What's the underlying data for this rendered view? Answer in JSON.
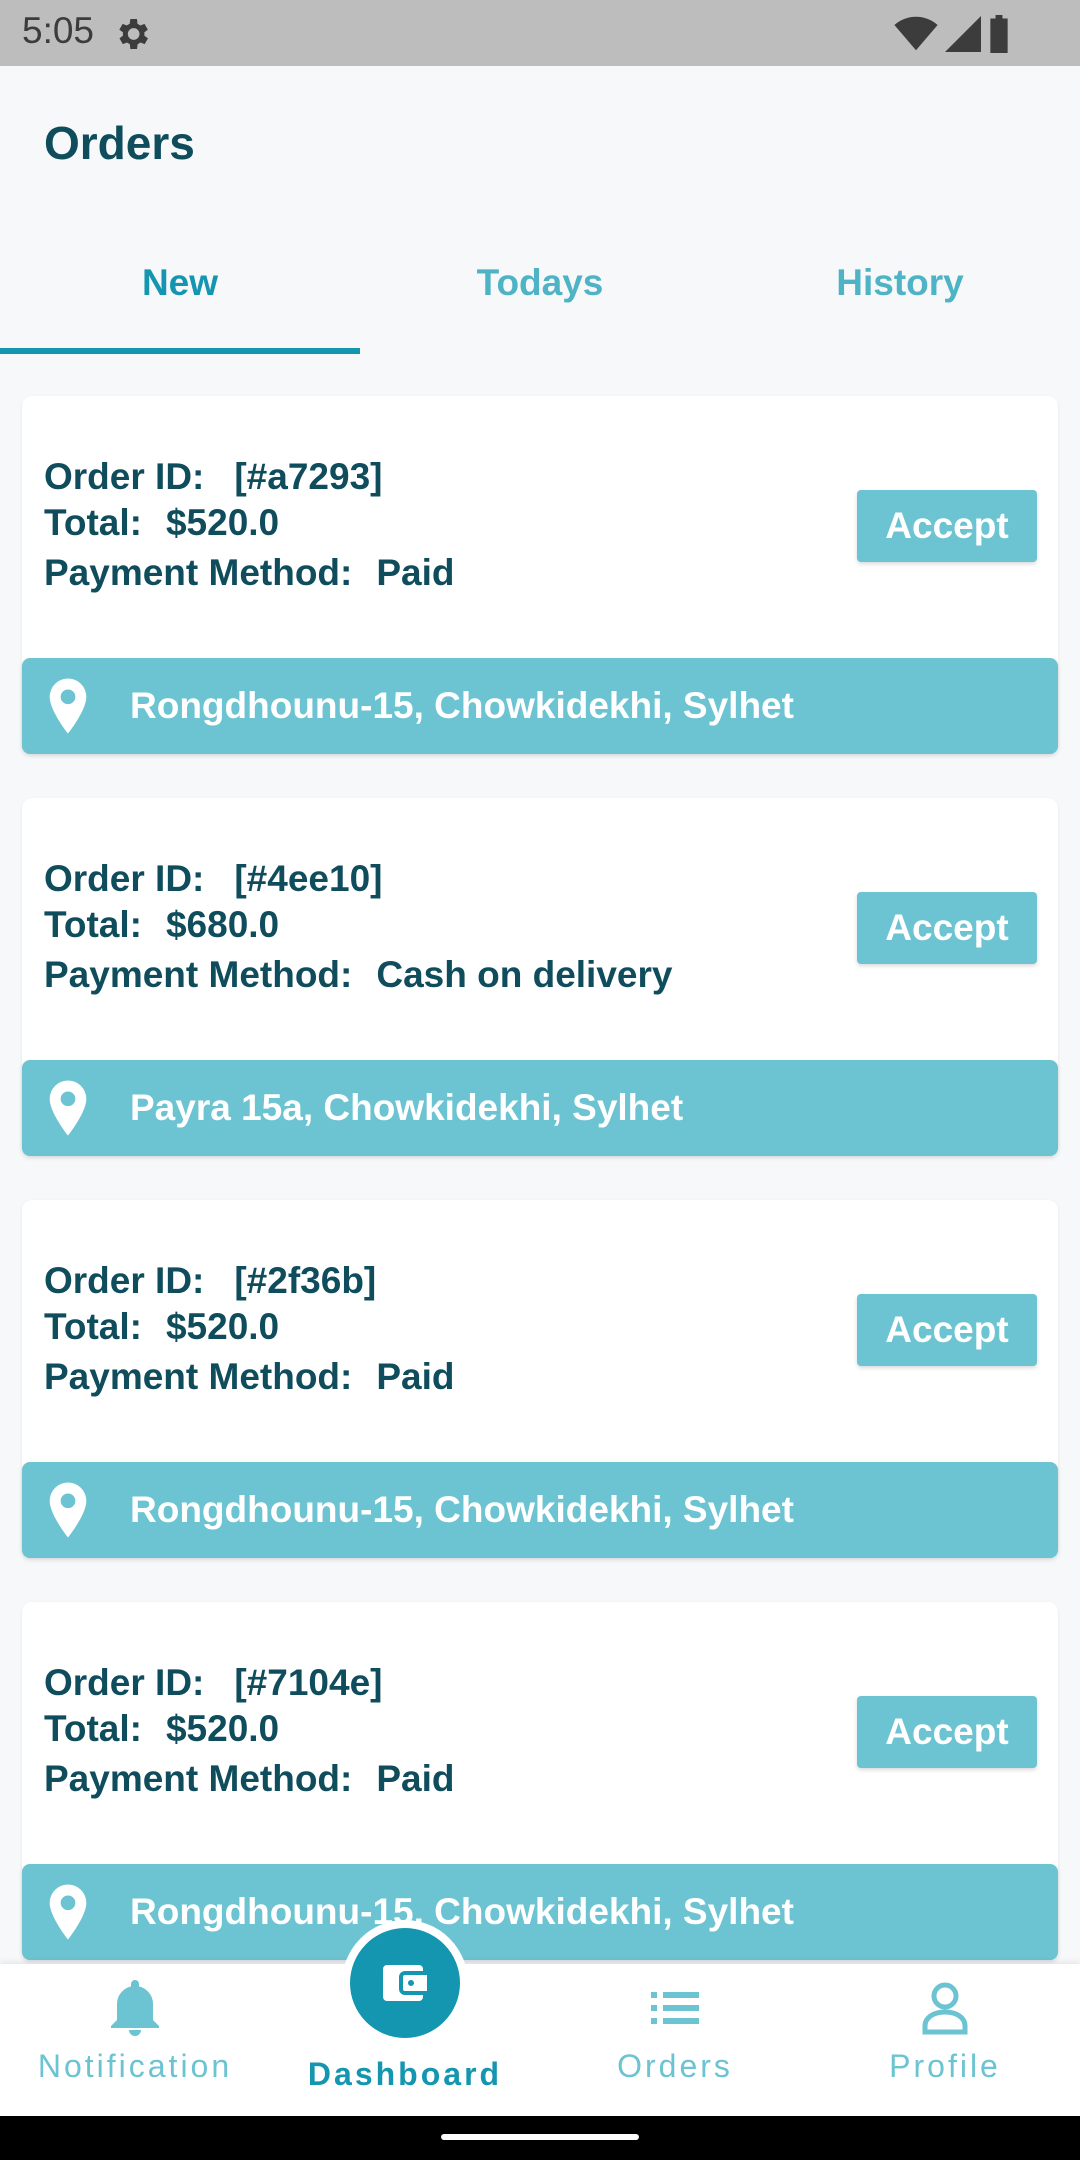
{
  "status_bar": {
    "time": "5:05"
  },
  "header": {
    "title": "Orders"
  },
  "tabs": [
    {
      "label": "New"
    },
    {
      "label": "Todays"
    },
    {
      "label": "History"
    }
  ],
  "orders": [
    {
      "id_label": "Order ID:",
      "id": "[#a7293]",
      "total_label": "Total:",
      "total": "$520.0",
      "payment_label": "Payment Method:",
      "payment": "Paid",
      "accept_label": "Accept",
      "address": "Rongdhounu-15, Chowkidekhi, Sylhet"
    },
    {
      "id_label": "Order ID:",
      "id": "[#4ee10]",
      "total_label": "Total:",
      "total": "$680.0",
      "payment_label": "Payment Method:",
      "payment": "Cash on delivery",
      "accept_label": "Accept",
      "address": "Payra 15a, Chowkidekhi, Sylhet"
    },
    {
      "id_label": "Order ID:",
      "id": "[#2f36b]",
      "total_label": "Total:",
      "total": "$520.0",
      "payment_label": "Payment Method:",
      "payment": "Paid",
      "accept_label": "Accept",
      "address": "Rongdhounu-15, Chowkidekhi, Sylhet"
    },
    {
      "id_label": "Order ID:",
      "id": "[#7104e]",
      "total_label": "Total:",
      "total": "$520.0",
      "payment_label": "Payment Method:",
      "payment": "Paid",
      "accept_label": "Accept",
      "address": "Rongdhounu-15, Chowkidekhi, Sylhet"
    }
  ],
  "bottom_nav": [
    {
      "label": "Notification",
      "icon": "bell-icon"
    },
    {
      "label": "Dashboard",
      "icon": "wallet-icon"
    },
    {
      "label": "Orders",
      "icon": "list-icon"
    },
    {
      "label": "Profile",
      "icon": "person-icon"
    }
  ],
  "colors": {
    "primary": "#1496b0",
    "accent": "#6cc3d1",
    "text": "#0f4c5c",
    "background": "#f7f8f9"
  }
}
